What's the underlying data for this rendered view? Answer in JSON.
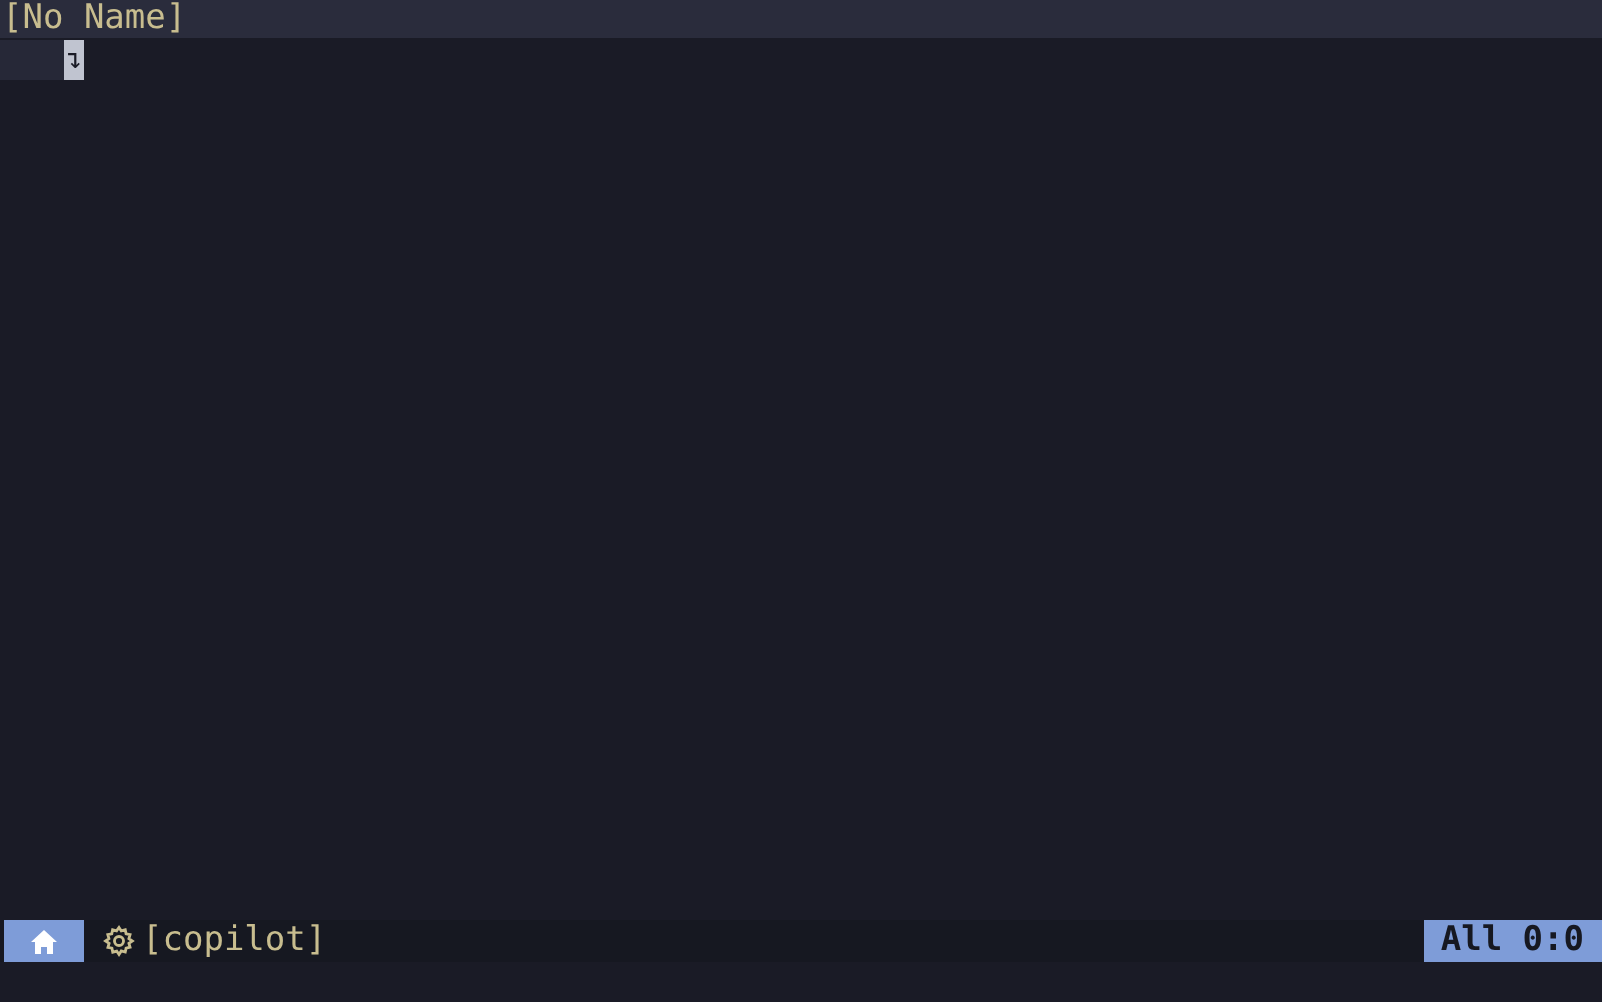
{
  "tabline": {
    "title": "[No Name]"
  },
  "buffer": {
    "lines": [
      {
        "text": "↴",
        "cursor": true
      }
    ]
  },
  "status_bar": {
    "plugin": "[copilot]",
    "position": "All 0:0"
  }
}
